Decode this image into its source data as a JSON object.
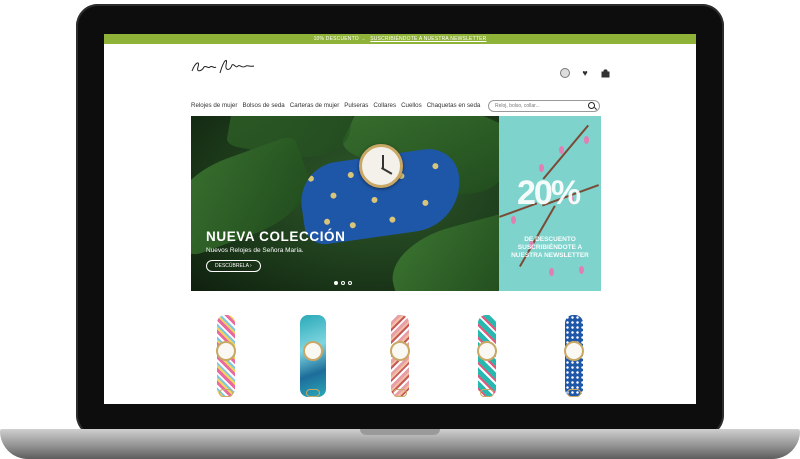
{
  "promo_bar": {
    "text": "10% DESCUENTO →",
    "link": "SUSCRIBIÉNDOTE A NUESTRA NEWSLETTER"
  },
  "brand": {
    "logo_text": "Señora María"
  },
  "header_icons": [
    "user-icon",
    "heart-icon",
    "bag-icon"
  ],
  "nav": {
    "items": [
      "Relojes de mujer",
      "Bolsos de seda",
      "Carteras de mujer",
      "Pulseras",
      "Collares",
      "Cuellos",
      "Chaquetas en seda"
    ],
    "search_placeholder": "Reloj, bolso, collar..."
  },
  "hero": {
    "title": "NUEVA COLECCIÓN",
    "subtitle": "Nuevos Relojes de Señora María.",
    "button": "DESCÚBRELA",
    "slide_count": 3,
    "active_slide": 1
  },
  "side_promo": {
    "percent": "20%",
    "text": "DE DESCUENTO SUSCRIBIÉNDOTE A NUESTRA NEWSLETTER"
  },
  "products": [
    {
      "color": "#e86aa0"
    },
    {
      "color": "#2aa9b8"
    },
    {
      "color": "#e8a0a8"
    },
    {
      "color": "#27b9b0"
    },
    {
      "color": "#1f57a8"
    }
  ],
  "colors": {
    "accent": "#8fb339"
  }
}
